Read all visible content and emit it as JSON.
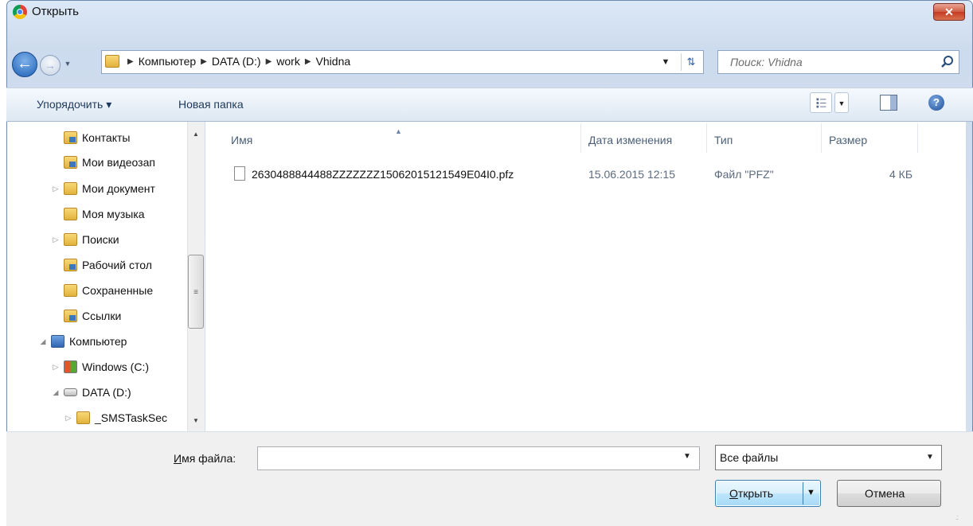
{
  "window": {
    "title": "Открыть",
    "close_glyph": "✕"
  },
  "address": {
    "crumbs": [
      "Компьютер",
      "DATA (D:)",
      "work",
      "Vhidna"
    ]
  },
  "search": {
    "placeholder": "Поиск: Vhidna"
  },
  "toolbar": {
    "organize": "Упорядочить ▾",
    "new_folder": "Новая папка"
  },
  "nav_pane": {
    "items": [
      {
        "label": "Контакты"
      },
      {
        "label": "Мои видеозап"
      },
      {
        "label": "Мои документ"
      },
      {
        "label": "Моя музыка"
      },
      {
        "label": "Поиски"
      },
      {
        "label": "Рабочий стол"
      },
      {
        "label": "Сохраненные"
      },
      {
        "label": "Ссылки"
      },
      {
        "label": "Компьютер"
      },
      {
        "label": "Windows (C:)"
      },
      {
        "label": "DATA (D:)"
      },
      {
        "label": "_SMSTaskSec"
      }
    ]
  },
  "columns": {
    "name": "Имя",
    "date": "Дата изменения",
    "type": "Тип",
    "size": "Размер"
  },
  "files": [
    {
      "name": "2630488844488ZZZZZZZ15062015121549E04I0.pfz",
      "date": "15.06.2015 12:15",
      "type": "Файл \"PFZ\"",
      "size": "4 КБ"
    }
  ],
  "bottom": {
    "filename_label_u": "И",
    "filename_label_rest": "мя файла:",
    "filename_value": "",
    "filetype_value": "Все файлы",
    "open_u": "О",
    "open_rest": "ткрыть",
    "cancel": "Отмена"
  },
  "colors": {
    "accent": "#3c7fb1",
    "close": "#c43a22"
  }
}
